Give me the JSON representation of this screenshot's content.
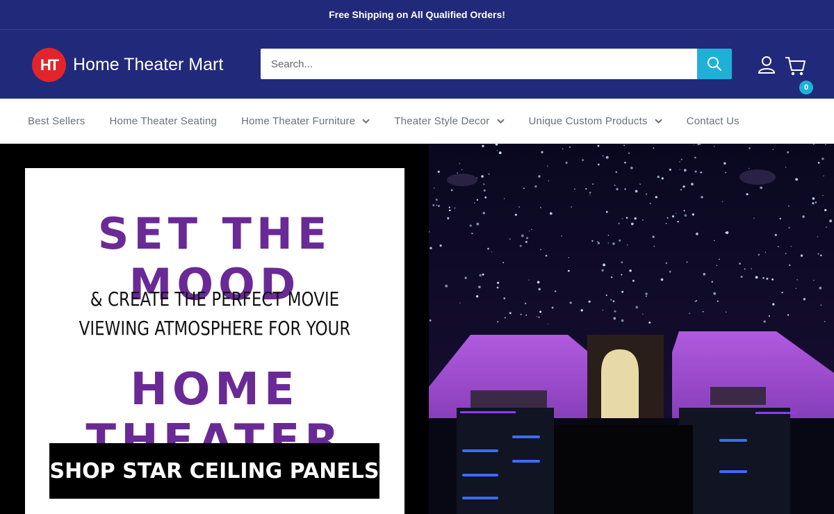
{
  "announcement": "Free Shipping on All Qualified Orders!",
  "header": {
    "logo_mark": "HT",
    "logo_text": "Home Theater Mart",
    "search_placeholder": "Search...",
    "cart_count": "0",
    "colors": {
      "bar": "#212a7a",
      "accent": "#1fb0d8",
      "logo_red": "#e2252b"
    }
  },
  "nav": {
    "items": [
      {
        "label": "Best Sellers",
        "dropdown": false
      },
      {
        "label": "Home Theater Seating",
        "dropdown": false
      },
      {
        "label": "Home Theater Furniture",
        "dropdown": true
      },
      {
        "label": "Theater Style Decor",
        "dropdown": true
      },
      {
        "label": "Unique Custom Products",
        "dropdown": true
      },
      {
        "label": "Contact Us",
        "dropdown": false
      }
    ]
  },
  "hero": {
    "headline_top": "SET THE MOOD",
    "subline_1": "& CREATE THE PERFECT MOVIE",
    "subline_2": "VIEWING ATMOSPHERE FOR YOUR",
    "headline_bottom": "HOME THEATER",
    "cta_label": "SHOP STAR CEILING PANELS",
    "headline_color": "#6a2a96"
  }
}
